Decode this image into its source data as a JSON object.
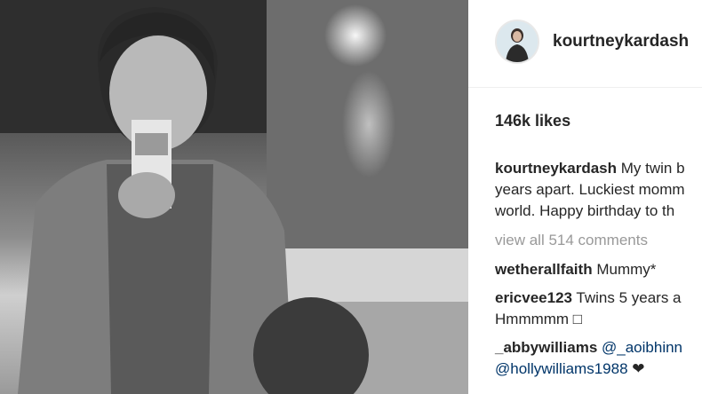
{
  "post": {
    "username": "kourtneykardash",
    "likes": "146k likes",
    "caption": {
      "author": "kourtneykardash",
      "line1": "My twin b",
      "line2": "years apart. Luckiest momm",
      "line3": "world. Happy birthday to th"
    },
    "view_all_comments": "view all 514 comments",
    "comments": [
      {
        "author": "wetherallfaith",
        "text": "Mummy*"
      },
      {
        "author": "ericvee123",
        "text": "Twins 5 years a",
        "text2": "Hmmmmm □"
      },
      {
        "author": "_abbywilliams",
        "mention1": "@_aoibhinn",
        "mention2": "@hollywilliams1988",
        "heart": "❤"
      }
    ]
  }
}
